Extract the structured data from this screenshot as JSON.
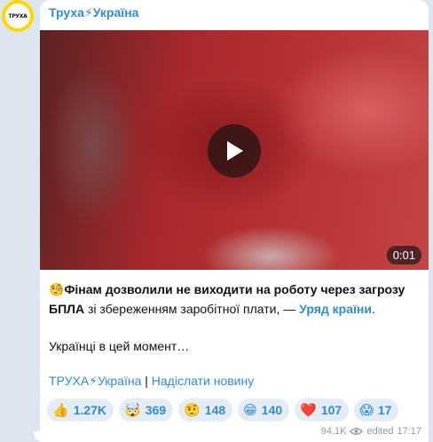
{
  "channel": {
    "name": "Труха⚡Україна",
    "avatar_text": "ТРУХА"
  },
  "video": {
    "duration": "0:01"
  },
  "post": {
    "lead_emoji": "🧐",
    "headline": "Фінам дозволили не виходити на роботу через загрозу БПЛА",
    "body_after": " зі збереженням заробітної плати, — ",
    "source_link": "Уряд країни",
    "body_end": ".",
    "second_paragraph": "Українці в цей момент…"
  },
  "footer": {
    "channel_link": "ТРУХА⚡Україна",
    "separator": " | ",
    "submit_link": "Надіслати новину"
  },
  "reactions": [
    {
      "icon": "thumbs-up-icon",
      "emoji": "👍",
      "count": "1.27K"
    },
    {
      "icon": "exploding-head-icon",
      "emoji": "🤯",
      "count": "369"
    },
    {
      "icon": "raised-eyebrow-icon",
      "emoji": "🤨",
      "count": "148"
    },
    {
      "icon": "grinning-icon",
      "emoji": "😁",
      "count": "140"
    },
    {
      "icon": "heart-icon",
      "emoji": "❤️",
      "count": "107"
    },
    {
      "icon": "screaming-face-icon",
      "emoji": "😱",
      "count": "17"
    }
  ],
  "meta": {
    "views": "94.1K",
    "edited_label": "edited",
    "time": "17:17"
  },
  "colors": {
    "accent": "#2f8bd6",
    "background": "#dde6ee",
    "reaction_bg": "#e4edf6",
    "avatar_ring": "#ffd600"
  }
}
